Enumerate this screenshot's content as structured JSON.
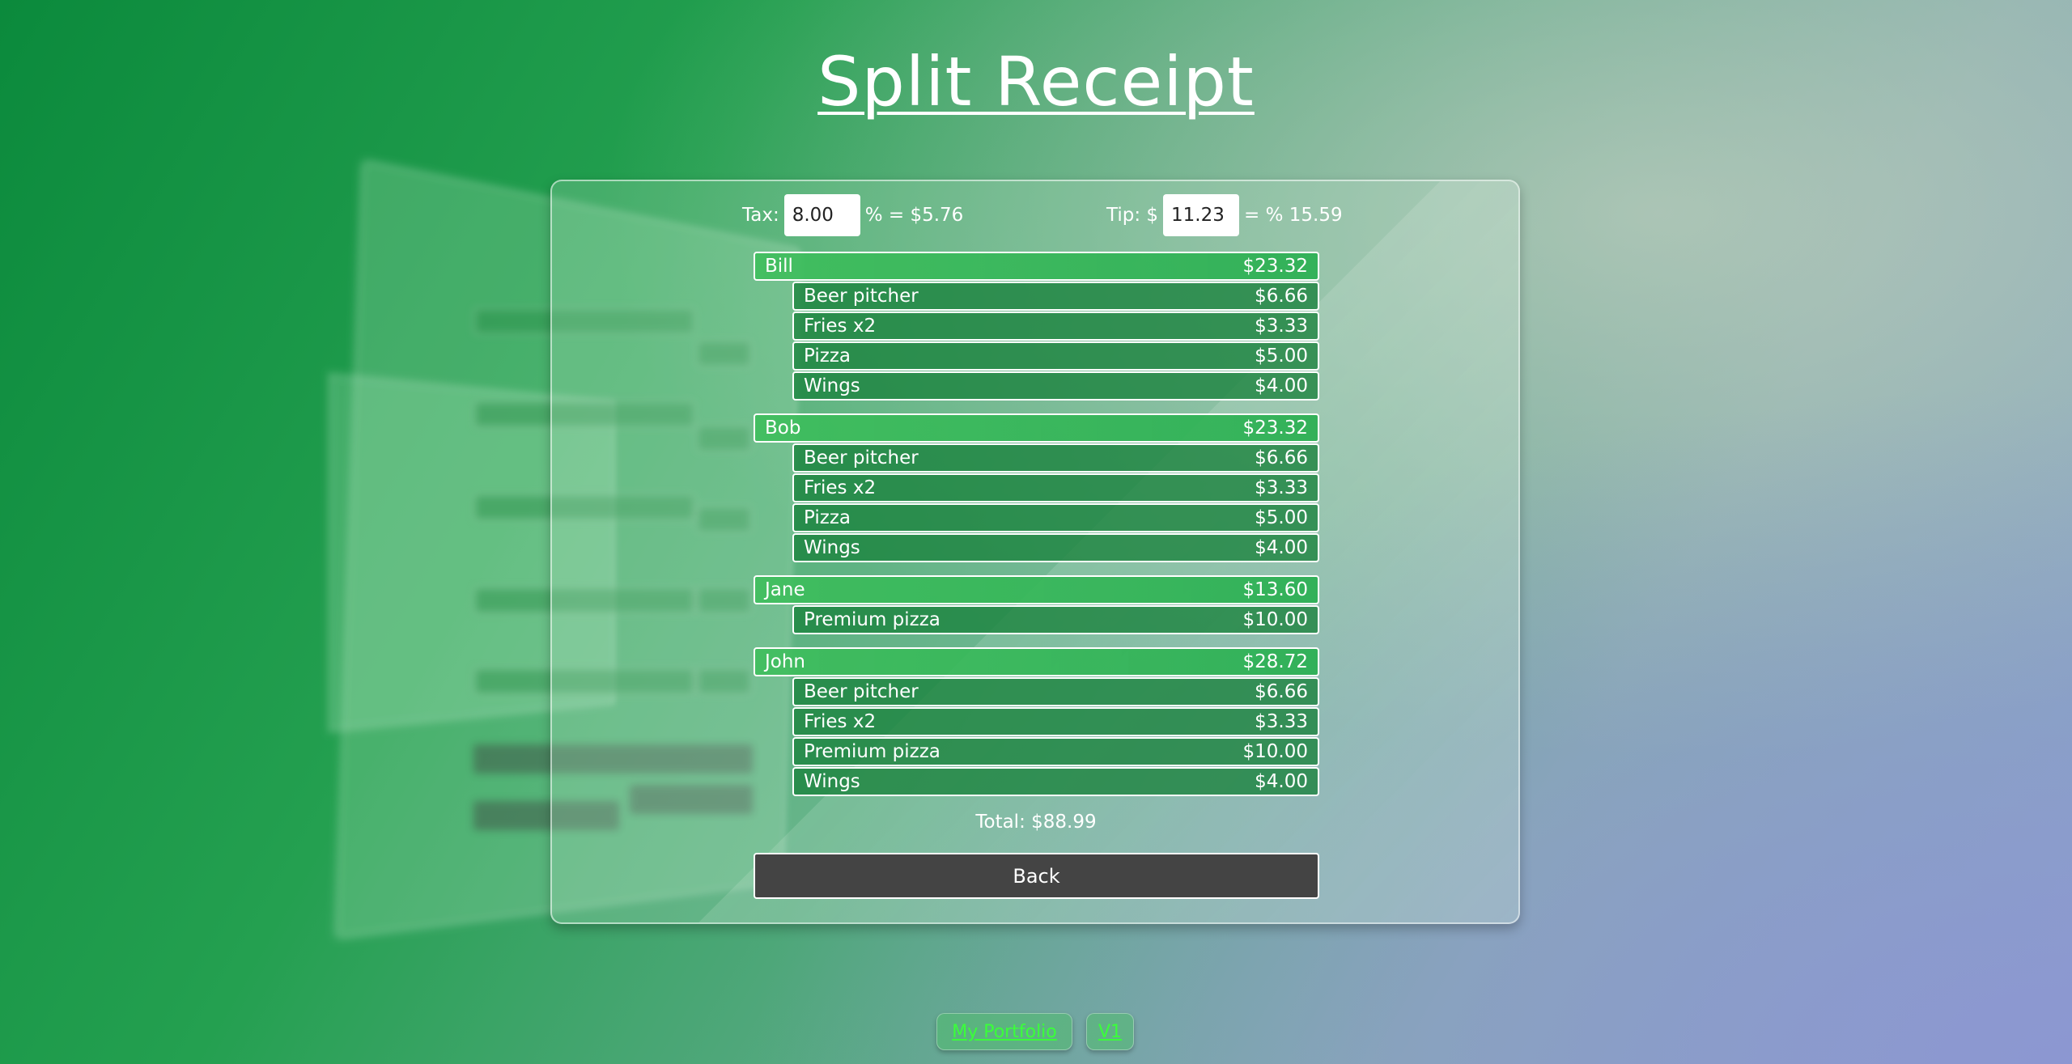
{
  "page": {
    "title": "Split Receipt"
  },
  "rates": {
    "tax_label": "Tax:",
    "tax_value": "8.00",
    "tax_result": "% = $5.76",
    "tip_label": "Tip: $",
    "tip_value": "11.23",
    "tip_result": "= % 15.59"
  },
  "people": [
    {
      "name": "Bill",
      "amount": "$23.32",
      "items": [
        {
          "name": "Beer pitcher",
          "amount": "$6.66"
        },
        {
          "name": "Fries x2",
          "amount": "$3.33"
        },
        {
          "name": "Pizza",
          "amount": "$5.00"
        },
        {
          "name": "Wings",
          "amount": "$4.00"
        }
      ]
    },
    {
      "name": "Bob",
      "amount": "$23.32",
      "items": [
        {
          "name": "Beer pitcher",
          "amount": "$6.66"
        },
        {
          "name": "Fries x2",
          "amount": "$3.33"
        },
        {
          "name": "Pizza",
          "amount": "$5.00"
        },
        {
          "name": "Wings",
          "amount": "$4.00"
        }
      ]
    },
    {
      "name": "Jane",
      "amount": "$13.60",
      "items": [
        {
          "name": "Premium pizza",
          "amount": "$10.00"
        }
      ]
    },
    {
      "name": "John",
      "amount": "$28.72",
      "items": [
        {
          "name": "Beer pitcher",
          "amount": "$6.66"
        },
        {
          "name": "Fries x2",
          "amount": "$3.33"
        },
        {
          "name": "Premium pizza",
          "amount": "$10.00"
        },
        {
          "name": "Wings",
          "amount": "$4.00"
        }
      ]
    }
  ],
  "total": "Total: $88.99",
  "back_label": "Back",
  "footer": {
    "portfolio_label": "My Portfolio",
    "version_label": "V1"
  },
  "colors": {
    "person_row": "#3cbe5a",
    "item_row": "#19823c",
    "back_button": "#444444",
    "footer_link": "#3aff3a"
  }
}
